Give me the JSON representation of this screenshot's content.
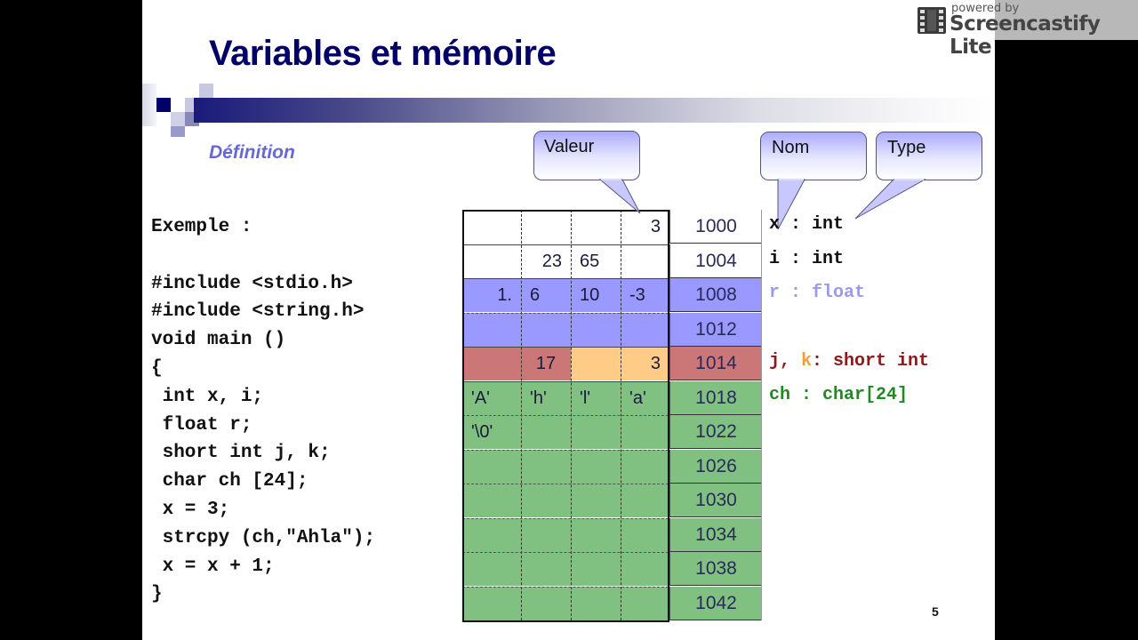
{
  "slide": {
    "title": "Variables et mémoire",
    "subtitle": "Définition",
    "page_number": "5",
    "code_lines": [
      "Exemple :",
      "",
      "#include <stdio.h>",
      "#include <string.h>",
      "void main ()",
      "{",
      " int x, i;",
      " float r;",
      " short int j, k;",
      " char ch [24];",
      " x = 3;",
      " strcpy (ch,\"Ahla\");",
      " x = x + 1;",
      "}"
    ],
    "callouts": {
      "value": "Valeur",
      "name": "Nom",
      "type": "Type"
    },
    "memory": {
      "colors": {
        "white": "#ffffff",
        "float": "#9999ff",
        "short_j": "#cc7777",
        "short_k": "#ffcc88",
        "char": "#80c080"
      },
      "rows": [
        {
          "address": "1000",
          "cells": [
            "",
            "",
            "",
            "3"
          ],
          "align": [
            "r",
            "r",
            "r",
            "r"
          ]
        },
        {
          "address": "1004",
          "cells": [
            "",
            "23",
            "65",
            ""
          ],
          "align": [
            "r",
            "r",
            "l",
            "l"
          ]
        },
        {
          "address": "1008",
          "cells": [
            "1.",
            "6",
            "10",
            "-3"
          ],
          "align": [
            "r",
            "l",
            "l",
            "l"
          ]
        },
        {
          "address": "1012",
          "cells": [
            "",
            "",
            "",
            ""
          ],
          "align": [
            "l",
            "l",
            "l",
            "l"
          ]
        },
        {
          "address": "1014",
          "cells": [
            "",
            "17",
            "",
            "3"
          ],
          "align": [
            "r",
            "c",
            "r",
            "r"
          ]
        },
        {
          "address": "1018",
          "cells": [
            "'A'",
            "'h'",
            "'l'",
            "'a'"
          ],
          "align": [
            "l",
            "l",
            "l",
            "l"
          ]
        },
        {
          "address": "1022",
          "cells": [
            "'\\0'",
            "",
            "",
            ""
          ],
          "align": [
            "l",
            "l",
            "l",
            "l"
          ]
        },
        {
          "address": "1026",
          "cells": [
            "",
            "",
            "",
            ""
          ],
          "align": [
            "l",
            "l",
            "l",
            "l"
          ]
        },
        {
          "address": "1030",
          "cells": [
            "",
            "",
            "",
            ""
          ],
          "align": [
            "l",
            "l",
            "l",
            "l"
          ]
        },
        {
          "address": "1034",
          "cells": [
            "",
            "",
            "",
            ""
          ],
          "align": [
            "l",
            "l",
            "l",
            "l"
          ]
        },
        {
          "address": "1038",
          "cells": [
            "",
            "",
            "",
            ""
          ],
          "align": [
            "l",
            "l",
            "l",
            "l"
          ]
        },
        {
          "address": "1042",
          "cells": [
            "",
            "",
            "",
            ""
          ],
          "align": [
            "l",
            "l",
            "l",
            "l"
          ]
        }
      ]
    },
    "declarations": [
      {
        "parts": [
          {
            "text": "x : int",
            "color": "#111111"
          }
        ]
      },
      {
        "parts": [
          {
            "text": "i : int",
            "color": "#111111"
          }
        ]
      },
      {
        "parts": [
          {
            "text": "r : float",
            "color": "#9999ee"
          }
        ]
      },
      {
        "parts": [
          {
            "text": "j, ",
            "color": "#8b1a1a"
          },
          {
            "text": "k",
            "color": "#f0a030"
          },
          {
            "text": ": short int",
            "color": "#8b1a1a"
          }
        ]
      },
      {
        "parts": [
          {
            "text": "ch : char[24]",
            "color": "#228822"
          }
        ]
      }
    ]
  },
  "watermark": {
    "powered_by": "powered by",
    "name": "Screencastify Lite"
  }
}
